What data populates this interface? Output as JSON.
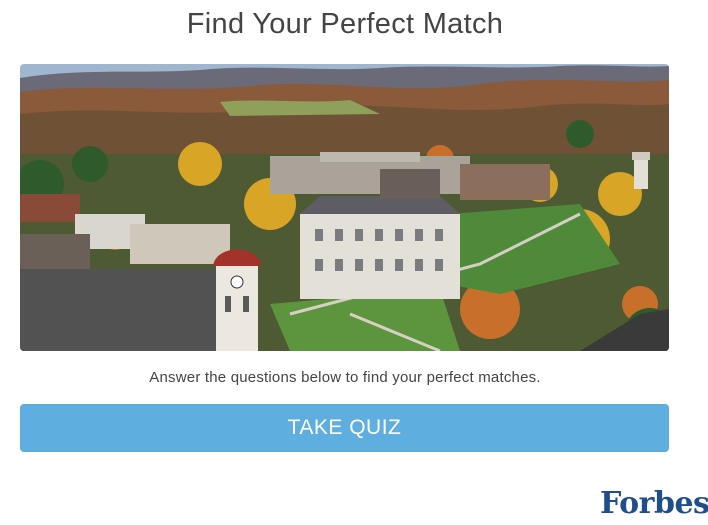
{
  "header": {
    "title": "Find Your Perfect Match"
  },
  "hero_image": {
    "description_icon": "campus-photo"
  },
  "body": {
    "instruction": "Answer the questions below to find your perfect matches."
  },
  "cta": {
    "label": "TAKE QUIZ",
    "color": "#5eaee0"
  },
  "branding": {
    "logo_text": "Forbes",
    "logo_color": "#1f4e8c"
  }
}
